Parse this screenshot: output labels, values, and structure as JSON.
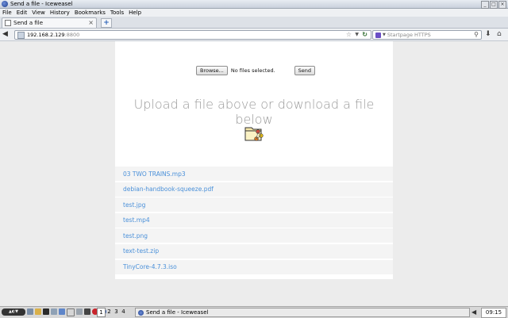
{
  "window": {
    "title": "Send a file - Iceweasel"
  },
  "menu": [
    "File",
    "Edit",
    "View",
    "History",
    "Bookmarks",
    "Tools",
    "Help"
  ],
  "tab": {
    "label": "Send a file"
  },
  "nav": {
    "url_host": "192.168.2.129",
    "url_port": ":8800",
    "search_placeholder": "Startpage HTTPS"
  },
  "upload": {
    "browse_label": "Browse...",
    "status": "No files selected.",
    "send_label": "Send"
  },
  "heading": "Upload a file above or download a file below",
  "files": [
    "03 TWO TRAINS.mp3",
    "debian-handbook-squeeze.pdf",
    "test.jpg",
    "test.mp4",
    "test.png",
    "text-test.zip",
    "TinyCore-4.7.3.iso"
  ],
  "taskbar": {
    "desktops": [
      "1",
      "2",
      "3",
      "4"
    ],
    "task_label": "Send a file - Iceweasel",
    "clock": "09:15"
  },
  "colors": {
    "link": "#4a90d9",
    "heading": "#9a9a9a",
    "page_bg": "#ececec"
  }
}
